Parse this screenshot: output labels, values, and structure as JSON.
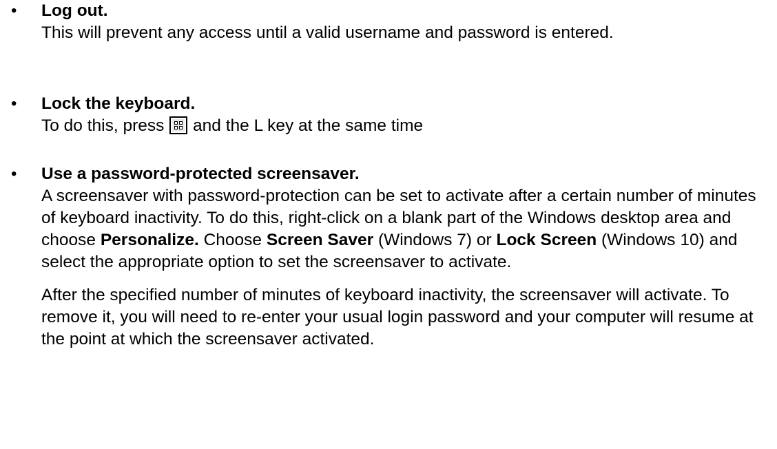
{
  "items": [
    {
      "heading": "Log out.",
      "body": "This will prevent any access until a valid username and password is entered."
    },
    {
      "heading": "Lock the keyboard.",
      "body_before": "To do this, press",
      "key_icon": "windows-key-icon",
      "body_after": "and the L key at the same time"
    },
    {
      "heading": "Use a password-protected screensaver.",
      "p1_a": "A screensaver with password-protection can be set to activate after a certain number of minutes of keyboard inactivity.  To do this, right-click on a blank part of the Windows desktop area and choose ",
      "p1_b": "Personalize.",
      "p1_c": "  Choose ",
      "p1_d": "Screen Saver",
      "p1_e": " (Windows 7) or ",
      "p1_f": "Lock Screen",
      "p1_g": " (Windows 10) and select the appropriate option to set the screensaver to activate.",
      "p2": "After the specified number of minutes of keyboard inactivity, the screensaver will activate.  To remove it, you will need to re-enter your usual login password and your computer will resume at the point at which the screensaver activated."
    }
  ],
  "bullet": "•"
}
